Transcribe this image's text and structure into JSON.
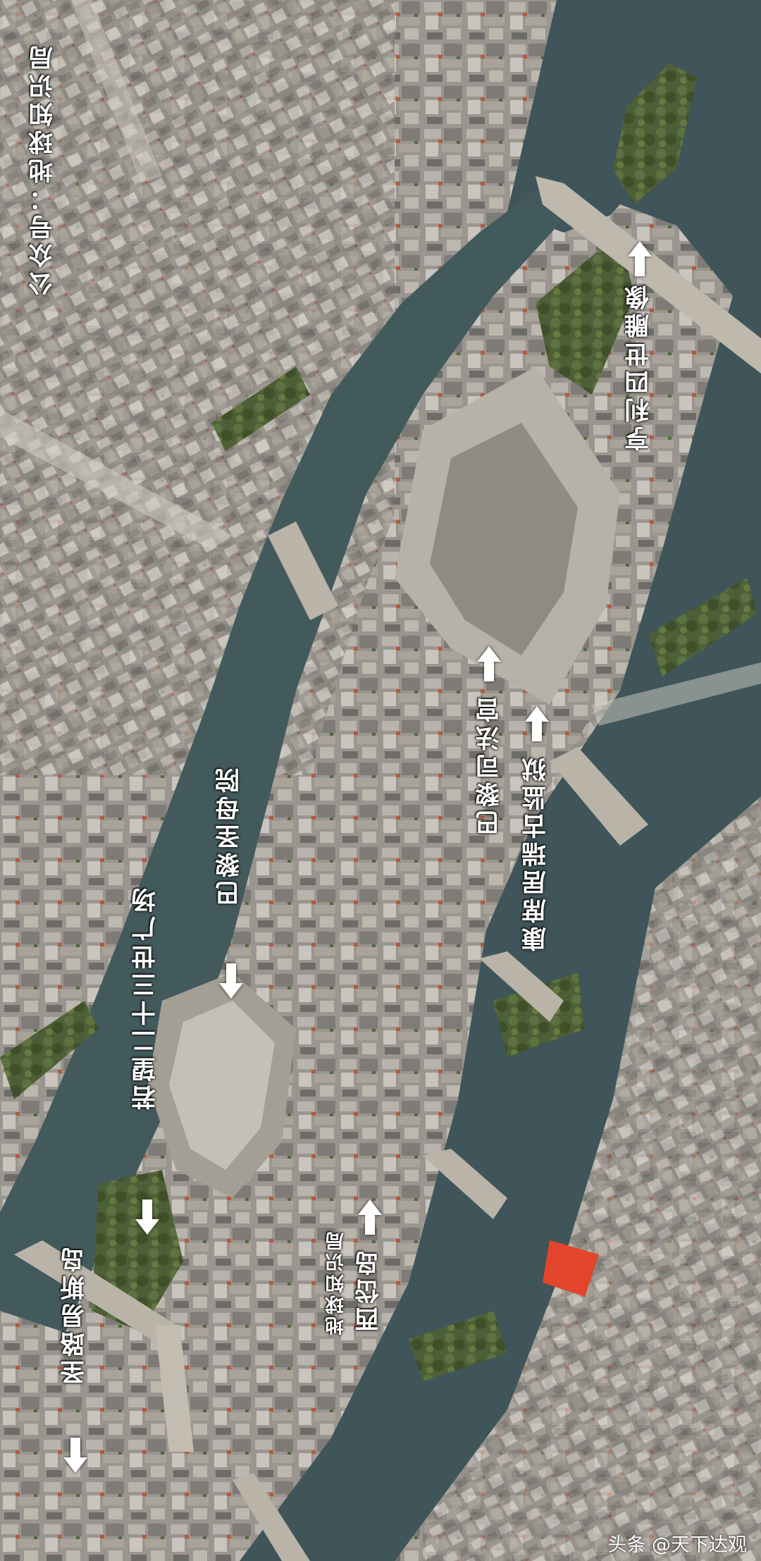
{
  "labels": {
    "credit_top": "公众号：地球知识局",
    "henri_iv": "亨利四世雕像",
    "palais_justice": "巴黎司法宫",
    "conciergerie": "康席居瑞古监狱",
    "notre_dame": "巴黎圣母院",
    "john_xxiii": "若望二十三世广场",
    "ile_cite": "西岱岛",
    "credit_bottom": "地球知识局",
    "ile_st_louis": "圣路易斯岛"
  },
  "watermark": "头条 @天下达观",
  "colors": {
    "river": "#3f5559",
    "label_text": "#ffffff",
    "roof_red": "#e2452c"
  },
  "icons": {
    "arrow": "arrow-icon"
  }
}
